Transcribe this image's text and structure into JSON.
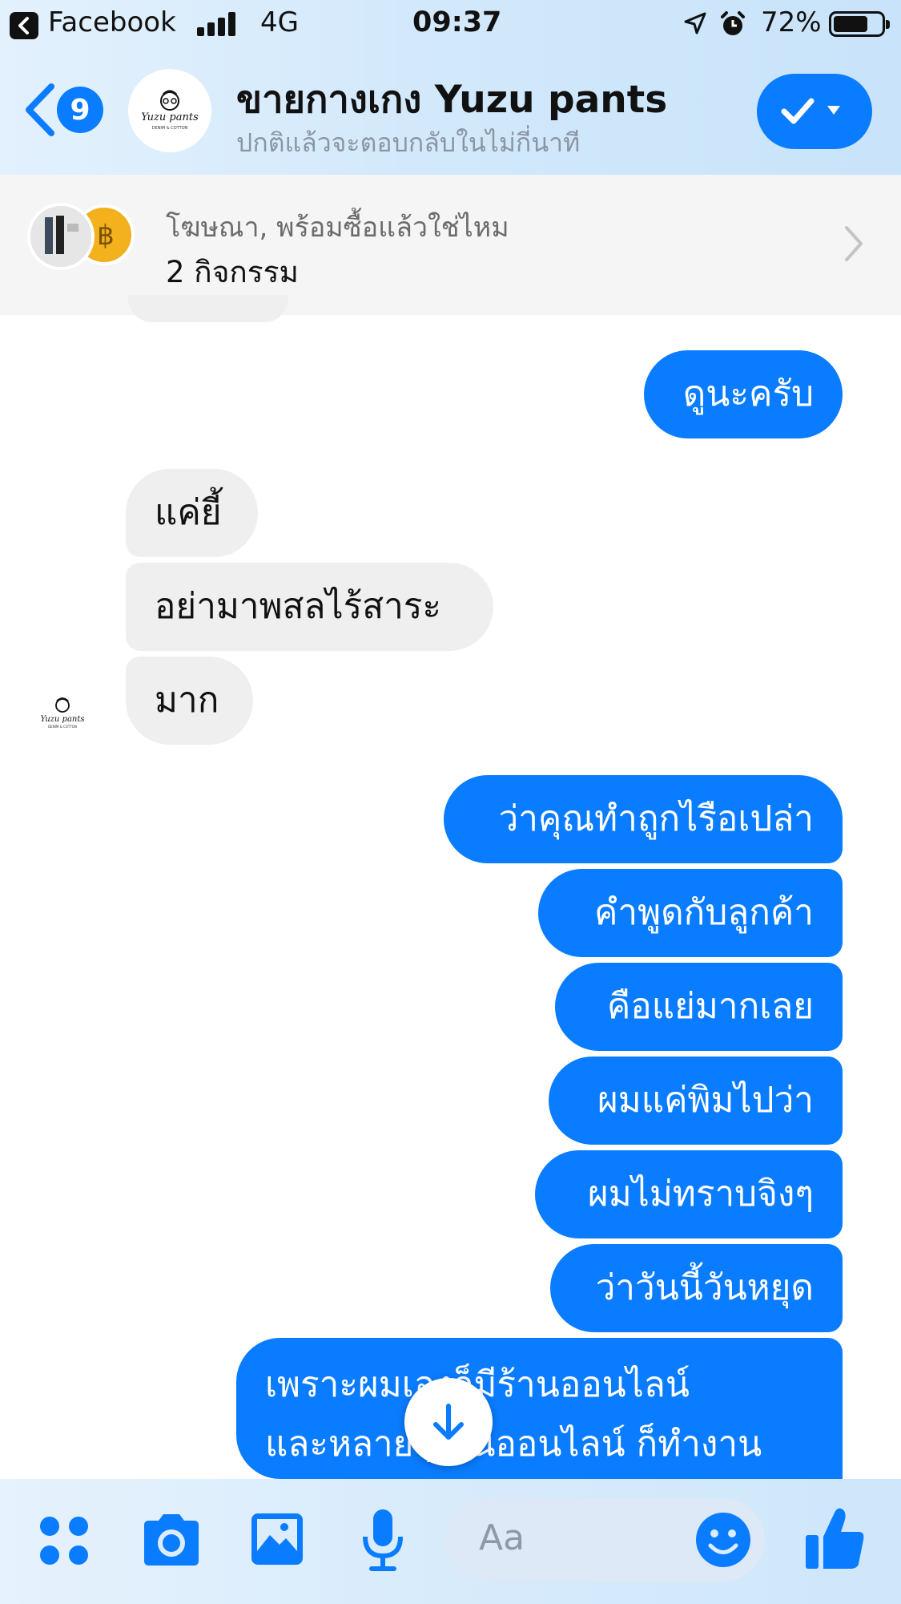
{
  "status_bar": {
    "back_app": "Facebook",
    "network": "4G",
    "time": "09:37",
    "battery": "72%",
    "battery_level": 0.72
  },
  "header": {
    "unread_count": "9",
    "title": "ขายกางเกง Yuzu pants",
    "subtitle": "ปกติแล้วจะตอบกลับในไม่กี่นาที",
    "avatar_logo": "Yuzu pants",
    "avatar_logo_sub": "DENIM & COTTON"
  },
  "ad_banner": {
    "line1": "โฆษณา, พร้อมซื้อแล้วใช่ไหม",
    "line2": "2 กิจกรรม"
  },
  "messages": [
    {
      "side": "out",
      "text": "ดูนะครับ"
    },
    {
      "side": "in",
      "text": "แค่ยี้"
    },
    {
      "side": "in",
      "text": "อย่ามาพสลไร้สาระ"
    },
    {
      "side": "in",
      "text": "มาก"
    },
    {
      "side": "out",
      "text": "ว่าคุณทำถูกไรือเปล่า"
    },
    {
      "side": "out",
      "text": "คำพูดกับลูกค้า"
    },
    {
      "side": "out",
      "text": "คือแย่มากเลย"
    },
    {
      "side": "out",
      "text": "ผมแค่พิมไปว่า"
    },
    {
      "side": "out",
      "text": "ผมไม่ทราบจิงๆ"
    },
    {
      "side": "out",
      "text": "ว่าวันนี้วันหยุด"
    },
    {
      "side": "out",
      "line1": "เพราะผมเองก็มีร้านออนไลน์",
      "line2": "และหลายๆร้านออนไลน์ ก็ทำงาน"
    }
  ],
  "composer": {
    "placeholder": "Aa"
  },
  "colors": {
    "accent": "#0a7cff",
    "incoming_bubble": "#efefef",
    "subtitle": "#8a96a3"
  },
  "icons": [
    "back-chevron-icon",
    "checkmark-icon",
    "dropdown-caret-icon",
    "chevron-right-icon",
    "arrow-down-icon",
    "apps-grid-icon",
    "camera-icon",
    "photo-gallery-icon",
    "microphone-icon",
    "smile-emoji-icon",
    "thumbs-up-icon",
    "location-arrow-icon",
    "alarm-clock-icon"
  ]
}
